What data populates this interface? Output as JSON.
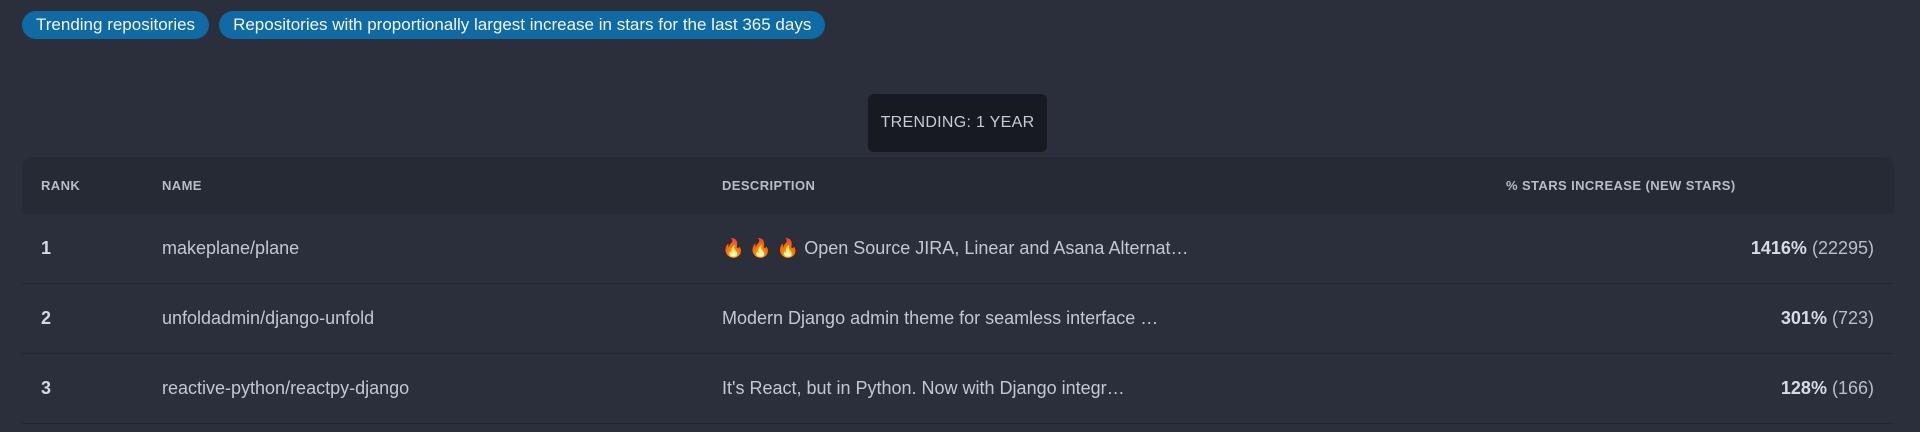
{
  "tags": [
    "Trending repositories",
    "Repositories with proportionally largest increase in stars for the last 365 days"
  ],
  "period_button": "TRENDING: 1 YEAR",
  "table": {
    "headers": {
      "rank": "RANK",
      "name": "NAME",
      "description": "DESCRIPTION",
      "stars": "% STARS INCREASE (NEW STARS)"
    },
    "rows": [
      {
        "rank": "1",
        "name": "makeplane/plane",
        "description": "🔥 🔥 🔥 Open Source JIRA, Linear and Asana Alternat…",
        "pct": "1416%",
        "new_stars": "(22295)"
      },
      {
        "rank": "2",
        "name": "unfoldadmin/django-unfold",
        "description": "Modern Django admin theme for seamless interface …",
        "pct": "301%",
        "new_stars": "(723)"
      },
      {
        "rank": "3",
        "name": "reactive-python/reactpy-django",
        "description": "It's React, but in Python. Now with Django integr…",
        "pct": "128%",
        "new_stars": "(166)"
      }
    ]
  }
}
